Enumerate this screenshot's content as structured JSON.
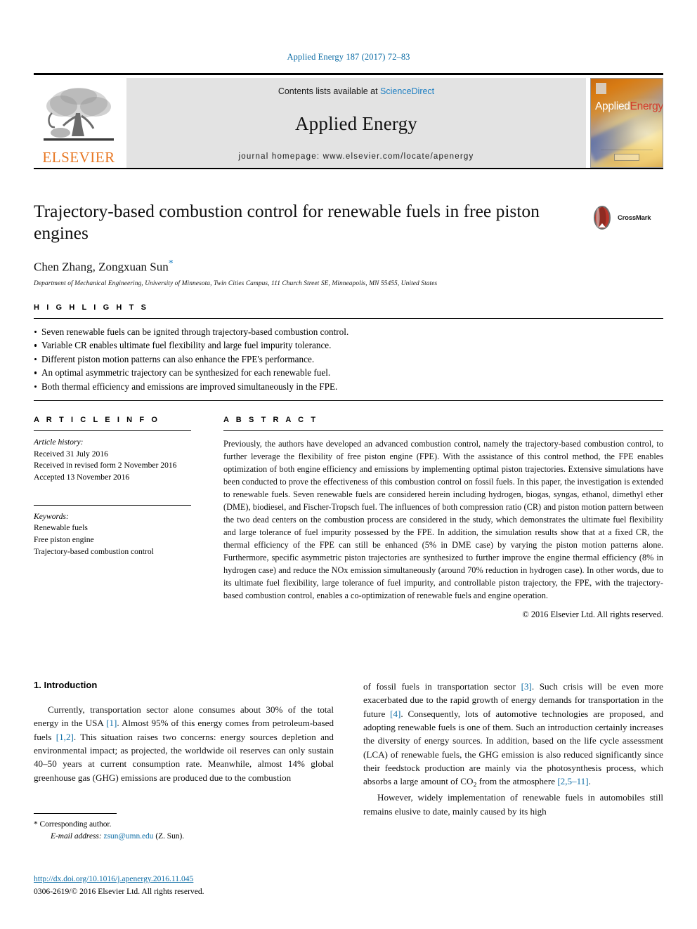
{
  "running_head": "Applied Energy 187 (2017) 72–83",
  "masthead": {
    "publisher": "ELSEVIER",
    "contents_prefix": "Contents lists available at ",
    "contents_link": "ScienceDirect",
    "journal_title": "Applied Energy",
    "homepage": "journal homepage: www.elsevier.com/locate/apenergy",
    "cover": {
      "title_part1": "Applied",
      "title_part2": "Energy"
    },
    "accent_blue": "#1d7fc3",
    "elsevier_orange": "#E87722"
  },
  "article": {
    "title": "Trajectory-based combustion control for renewable fuels in free piston engines",
    "authors": "Chen Zhang, Zongxuan Sun",
    "corresponding_marker": "*",
    "affiliation": "Department of Mechanical Engineering, University of Minnesota, Twin Cities Campus, 111 Church Street SE, Minneapolis, MN 55455, United States",
    "crossmark_label": "CrossMark"
  },
  "highlights": {
    "heading": "H I G H L I G H T S",
    "items": [
      "Seven renewable fuels can be ignited through trajectory-based combustion control.",
      "Variable CR enables ultimate fuel flexibility and large fuel impurity tolerance.",
      "Different piston motion patterns can also enhance the FPE's performance.",
      "An optimal asymmetric trajectory can be synthesized for each renewable fuel.",
      "Both thermal efficiency and emissions are improved simultaneously in the FPE."
    ]
  },
  "article_info": {
    "heading": "A R T I C L E  I N F O",
    "history_label": "Article history:",
    "history": [
      "Received 31 July 2016",
      "Received in revised form 2 November 2016",
      "Accepted 13 November 2016"
    ],
    "keywords_label": "Keywords:",
    "keywords": [
      "Renewable fuels",
      "Free piston engine",
      "Trajectory-based combustion control"
    ]
  },
  "abstract": {
    "heading": "A B S T R A C T",
    "text": "Previously, the authors have developed an advanced combustion control, namely the trajectory-based combustion control, to further leverage the flexibility of free piston engine (FPE). With the assistance of this control method, the FPE enables optimization of both engine efficiency and emissions by implementing optimal piston trajectories. Extensive simulations have been conducted to prove the effectiveness of this combustion control on fossil fuels. In this paper, the investigation is extended to renewable fuels. Seven renewable fuels are considered herein including hydrogen, biogas, syngas, ethanol, dimethyl ether (DME), biodiesel, and Fischer-Tropsch fuel. The influences of both compression ratio (CR) and piston motion pattern between the two dead centers on the combustion process are considered in the study, which demonstrates the ultimate fuel flexibility and large tolerance of fuel impurity possessed by the FPE. In addition, the simulation results show that at a fixed CR, the thermal efficiency of the FPE can still be enhanced (5% in DME case) by varying the piston motion patterns alone. Furthermore, specific asymmetric piston trajectories are synthesized to further improve the engine thermal efficiency (8% in hydrogen case) and reduce the NOx emission simultaneously (around 70% reduction in hydrogen case). In other words, due to its ultimate fuel flexibility, large tolerance of fuel impurity, and controllable piston trajectory, the FPE, with the trajectory-based combustion control, enables a co-optimization of renewable fuels and engine operation.",
    "copyright": "© 2016 Elsevier Ltd. All rights reserved."
  },
  "body": {
    "section_heading": "1. Introduction",
    "left_paragraph_a": "Currently, transportation sector alone consumes about 30% of the total energy in the USA ",
    "left_ref_1": "[1]",
    "left_paragraph_b": ". Almost 95% of this energy comes from petroleum-based fuels ",
    "left_ref_2": "[1,2]",
    "left_paragraph_c": ". This situation raises two concerns: energy sources depletion and environmental impact; as projected, the worldwide oil reserves can only sustain 40–50 years at current consumption rate. Meanwhile, almost 14% global greenhouse gas (GHG) emissions are produced due to the combustion",
    "right_paragraph_a": "of fossil fuels in transportation sector ",
    "right_ref_3": "[3]",
    "right_paragraph_b": ". Such crisis will be even more exacerbated due to the rapid growth of energy demands for transportation in the future ",
    "right_ref_4": "[4]",
    "right_paragraph_c": ". Consequently, lots of automotive technologies are proposed, and adopting renewable fuels is one of them. Such an introduction certainly increases the diversity of energy sources. In addition, based on the life cycle assessment (LCA) of renewable fuels, the GHG emission is also reduced significantly since their feedstock production are mainly via the photosynthesis process, which absorbs a large amount of CO",
    "co2_sub": "2",
    "right_paragraph_d": " from the atmosphere ",
    "right_ref_5": "[2,5–11]",
    "right_paragraph_e": ".",
    "right_paragraph_f": "However, widely implementation of renewable fuels in automobiles still remains elusive to date, mainly caused by its high"
  },
  "footnote": {
    "corresponding": "* Corresponding author.",
    "email_label": "E-mail address:",
    "email": "zsun@umn.edu",
    "email_suffix": "(Z. Sun).",
    "doi": "http://dx.doi.org/10.1016/j.apenergy.2016.11.045",
    "issn_line": "0306-2619/© 2016 Elsevier Ltd. All rights reserved."
  }
}
